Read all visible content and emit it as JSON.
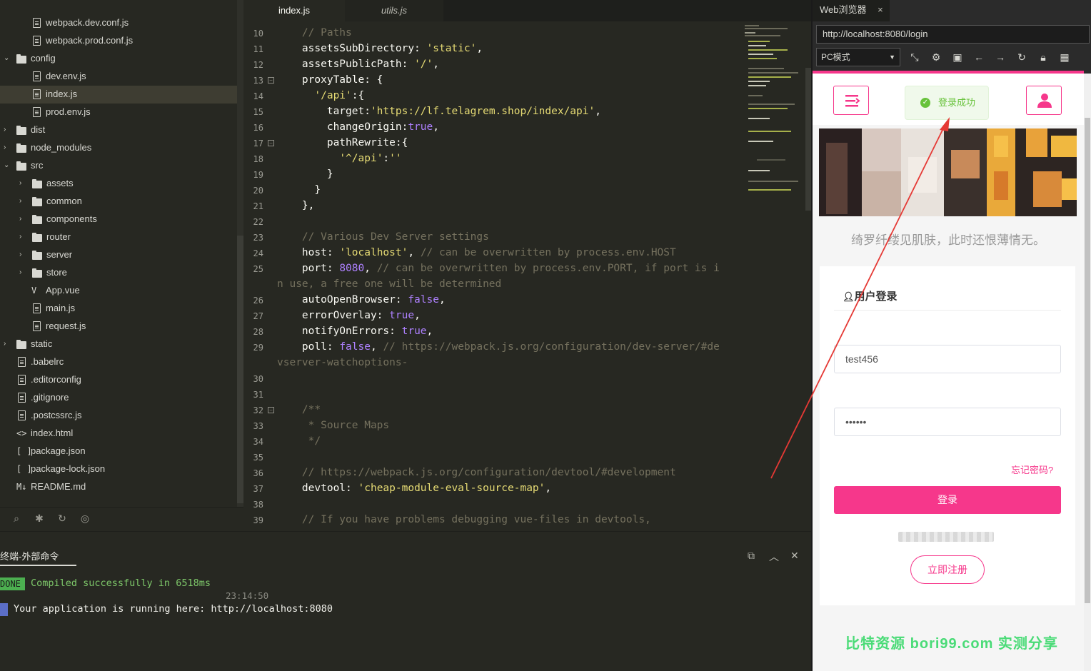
{
  "sidebar": {
    "items": [
      {
        "label": "webpack.dev.conf.js",
        "type": "file"
      },
      {
        "label": "webpack.prod.conf.js",
        "type": "file"
      },
      {
        "label": "config",
        "type": "folder-open"
      },
      {
        "label": "dev.env.js",
        "type": "file"
      },
      {
        "label": "index.js",
        "type": "file"
      },
      {
        "label": "prod.env.js",
        "type": "file"
      },
      {
        "label": "dist",
        "type": "folder"
      },
      {
        "label": "node_modules",
        "type": "folder"
      },
      {
        "label": "src",
        "type": "folder-open"
      },
      {
        "label": "assets",
        "type": "folder"
      },
      {
        "label": "common",
        "type": "folder"
      },
      {
        "label": "components",
        "type": "folder"
      },
      {
        "label": "router",
        "type": "folder"
      },
      {
        "label": "server",
        "type": "folder"
      },
      {
        "label": "store",
        "type": "folder"
      },
      {
        "label": "App.vue",
        "type": "vue"
      },
      {
        "label": "main.js",
        "type": "file"
      },
      {
        "label": "request.js",
        "type": "file"
      },
      {
        "label": "static",
        "type": "folder"
      },
      {
        "label": ".babelrc",
        "type": "file"
      },
      {
        "label": ".editorconfig",
        "type": "file"
      },
      {
        "label": ".gitignore",
        "type": "file"
      },
      {
        "label": ".postcssrc.js",
        "type": "file"
      },
      {
        "label": "index.html",
        "type": "html"
      },
      {
        "label": "package.json",
        "type": "json"
      },
      {
        "label": "package-lock.json",
        "type": "json"
      },
      {
        "label": "README.md",
        "type": "md"
      }
    ],
    "selected": "index.js"
  },
  "editor": {
    "tabs": [
      {
        "label": "index.js",
        "active": true
      },
      {
        "label": "utils.js",
        "active": false
      }
    ],
    "lines": [
      {
        "n": "10",
        "text": "    // Paths"
      },
      {
        "n": "11",
        "text": "    assetsSubDirectory: 'static',"
      },
      {
        "n": "12",
        "text": "    assetsPublicPath: '/',"
      },
      {
        "n": "13",
        "text": "    proxyTable: {"
      },
      {
        "n": "14",
        "text": "      '/api':{"
      },
      {
        "n": "15",
        "text": "        target:'https://lf.telagrem.shop/index/api',"
      },
      {
        "n": "16",
        "text": "        changeOrigin:true,"
      },
      {
        "n": "17",
        "text": "        pathRewrite:{"
      },
      {
        "n": "18",
        "text": "          '^/api':''"
      },
      {
        "n": "19",
        "text": "        }"
      },
      {
        "n": "20",
        "text": "      }"
      },
      {
        "n": "21",
        "text": "    },"
      },
      {
        "n": "22",
        "text": ""
      },
      {
        "n": "23",
        "text": "    // Various Dev Server settings"
      },
      {
        "n": "24",
        "text": "    host: 'localhost', // can be overwritten by process.env.HOST"
      },
      {
        "n": "25",
        "text": "    port: 8080, // can be overwritten by process.env.PORT, if port is i"
      },
      {
        "n": "",
        "text": "n use, a free one will be determined"
      },
      {
        "n": "26",
        "text": "    autoOpenBrowser: false,"
      },
      {
        "n": "27",
        "text": "    errorOverlay: true,"
      },
      {
        "n": "28",
        "text": "    notifyOnErrors: true,"
      },
      {
        "n": "29",
        "text": "    poll: false, // https://webpack.js.org/configuration/dev-server/#de"
      },
      {
        "n": "",
        "text": "vserver-watchoptions-"
      },
      {
        "n": "30",
        "text": ""
      },
      {
        "n": "31",
        "text": ""
      },
      {
        "n": "32",
        "text": "    /**"
      },
      {
        "n": "33",
        "text": "     * Source Maps"
      },
      {
        "n": "34",
        "text": "     */"
      },
      {
        "n": "35",
        "text": ""
      },
      {
        "n": "36",
        "text": "    // https://webpack.js.org/configuration/devtool/#development"
      },
      {
        "n": "37",
        "text": "    devtool: 'cheap-module-eval-source-map',"
      },
      {
        "n": "38",
        "text": ""
      },
      {
        "n": "39",
        "text": "    // If you have problems debugging vue-files in devtools,"
      }
    ]
  },
  "terminal": {
    "title": "终端-外部命令",
    "done_badge": "DONE",
    "compiled": "Compiled successfully in 6518ms",
    "time": "23:14:50",
    "running": "Your application is running here: http://localhost:8080"
  },
  "browser": {
    "tab_label": "Web浏览器",
    "tab_close": "×",
    "url": "http://localhost:8080/login",
    "mode": "PC模式",
    "toast": "登录成功",
    "slogan": "绮罗纤缕见肌肤，此时还恨薄情无。",
    "login_title": "用户登录",
    "username": "test456",
    "password": "••••••",
    "forgot": "忘记密码?",
    "login_button": "登录",
    "register_button": "立即注册",
    "watermark": "比特资源  bori99.com  实测分享"
  },
  "colors": {
    "accent": "#f6378b",
    "editor_bg": "#272822",
    "success": "#67c23a"
  }
}
